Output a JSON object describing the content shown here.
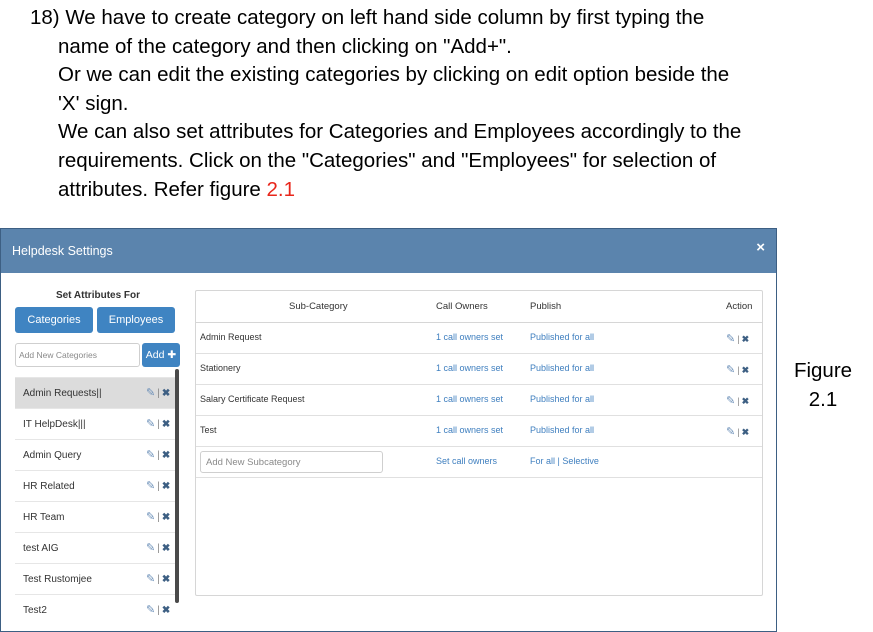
{
  "instructions": {
    "line1": "18) We have to create category on left hand side column by first typing the",
    "line2": "name of the category and then clicking on \"Add+\".",
    "line3": "Or we can edit the existing categories by clicking on edit option beside the",
    "line4": "'X' sign.",
    "line5": "We can also set attributes for Categories and Employees accordingly to the",
    "line6": "requirements. Click on the \"Categories\" and \"Employees\" for selection of",
    "line7_prefix": "attributes. Refer figure ",
    "line7_ref": "2.1"
  },
  "caption": {
    "line1": "Figure",
    "line2": "2.1"
  },
  "modal": {
    "title": "Helpdesk Settings",
    "close": "×"
  },
  "left": {
    "heading": "Set Attributes For",
    "categories_btn": "Categories",
    "employees_btn": "Employees",
    "input_placeholder": "Add New Categories",
    "add_btn": "Add ✚",
    "items": [
      {
        "name": "Admin Requests||"
      },
      {
        "name": "IT HelpDesk|||"
      },
      {
        "name": "Admin Query"
      },
      {
        "name": "HR Related"
      },
      {
        "name": "HR Team"
      },
      {
        "name": "test AIG"
      },
      {
        "name": "Test Rustomjee"
      },
      {
        "name": "Test2"
      }
    ],
    "edit_glyph": "✎",
    "sep": "|",
    "delete_glyph": "✖"
  },
  "table": {
    "headers": {
      "sub": "Sub-Category",
      "owners": "Call Owners",
      "publish": "Publish",
      "action": "Action"
    },
    "rows": [
      {
        "sub": "Admin Request",
        "owners": "1 call owners set",
        "publish": "Published for all"
      },
      {
        "sub": "Stationery",
        "owners": "1 call owners set",
        "publish": "Published for all"
      },
      {
        "sub": "Salary Certificate Request",
        "owners": "1 call owners set",
        "publish": "Published for all"
      },
      {
        "sub": "Test",
        "owners": "1 call owners set",
        "publish": "Published for all"
      }
    ],
    "new_row": {
      "placeholder": "Add New Subcategory",
      "set_owners": "Set call owners",
      "for_all": "For all",
      "sep": "|",
      "selective": "Selective"
    }
  },
  "colors": {
    "header": "#5b84ad",
    "button": "#3f84c2",
    "link": "#3f7fbf",
    "ref": "#e8261b"
  }
}
